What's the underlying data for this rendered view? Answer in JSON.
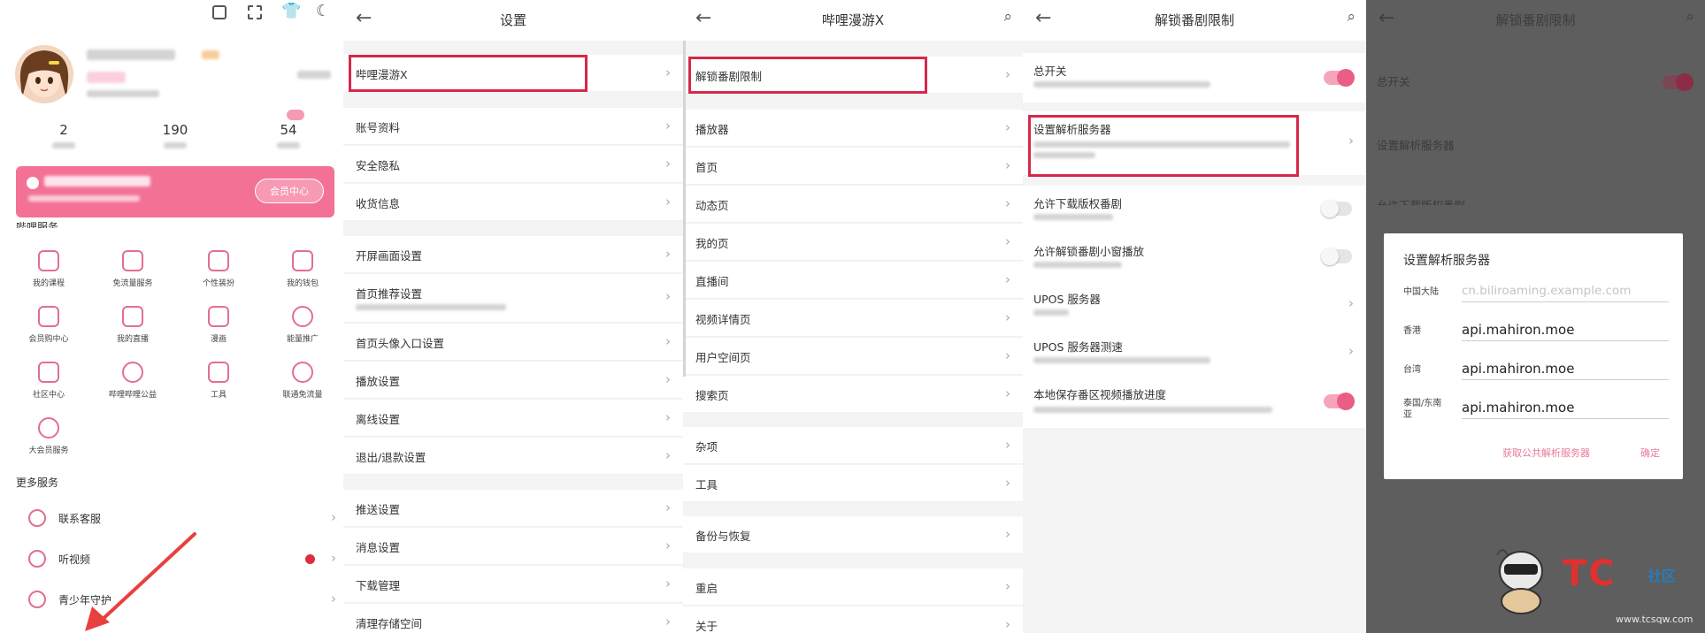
{
  "colors": {
    "accent": "#e8507a",
    "highlight_box": "#d6284a",
    "overlay": "#5e5e5e"
  },
  "panel1": {
    "header_icons": [
      "scan-frame-icon",
      "scan-icon",
      "tshirt-icon",
      "moon-icon"
    ],
    "stats": [
      {
        "value": "2"
      },
      {
        "value": "190"
      },
      {
        "value": "54"
      }
    ],
    "services_title": "哔哩服务",
    "services": [
      "我的课程",
      "免流量服务",
      "个性装扮",
      "我的钱包",
      "会员购中心",
      "我的直播",
      "漫画",
      "能量推广",
      "社区中心",
      "哔哩哔哩公益",
      "工具",
      "联通免流量",
      "大会员服务"
    ],
    "more_title": "更多服务",
    "more_items": [
      {
        "label": "联系客服"
      },
      {
        "label": "听视频"
      },
      {
        "label": "青少年守护"
      }
    ],
    "vip_button": "会员中心"
  },
  "panel2": {
    "title": "设置",
    "rows": [
      "哔哩漫游X",
      "账号资料",
      "安全隐私",
      "收货信息",
      "开屏画面设置",
      "首页推荐设置",
      "首页头像入口设置",
      "播放设置",
      "离线设置",
      "退出/退款设置",
      "推送设置",
      "消息设置",
      "下载管理",
      "清理存储空间"
    ]
  },
  "panel3": {
    "title": "哔哩漫游X",
    "rows": [
      "解锁番剧限制",
      "播放器",
      "首页",
      "动态页",
      "我的页",
      "直播间",
      "视频详情页",
      "用户空间页",
      "搜索页",
      "杂项",
      "工具",
      "备份与恢复",
      "重启",
      "关于"
    ]
  },
  "panel4": {
    "title": "解锁番剧限制",
    "rows": [
      {
        "label": "总开关",
        "toggle": "on"
      },
      {
        "label": "设置解析服务器",
        "toggle": "none"
      },
      {
        "label": "允许下载版权番剧",
        "toggle": "off"
      },
      {
        "label": "允许解锁番剧小窗播放",
        "toggle": "off"
      },
      {
        "label": "UPOS 服务器",
        "toggle": "none"
      },
      {
        "label": "UPOS 服务器测速",
        "toggle": "none"
      },
      {
        "label": "本地保存番区视频播放进度",
        "toggle": "on"
      }
    ]
  },
  "panel5": {
    "bg_title": "解锁番剧限制",
    "bg_rows": [
      "总开关",
      "设置解析服务器",
      "允许下载版权番剧"
    ],
    "dialog": {
      "title": "设置解析服务器",
      "fields": [
        {
          "label": "中国大陆",
          "value": "",
          "placeholder": "cn.biliroaming.example.com"
        },
        {
          "label": "香港",
          "value": "api.mahiron.moe",
          "placeholder": ""
        },
        {
          "label": "台湾",
          "value": "api.mahiron.moe",
          "placeholder": ""
        },
        {
          "label": "泰国/东南亚",
          "value": "api.mahiron.moe",
          "placeholder": ""
        }
      ],
      "btn_public": "获取公共解析服务器",
      "btn_ok": "确定"
    }
  },
  "watermark": {
    "logo": "TC",
    "tag": "社区",
    "url": "www.tcsqw.com"
  }
}
